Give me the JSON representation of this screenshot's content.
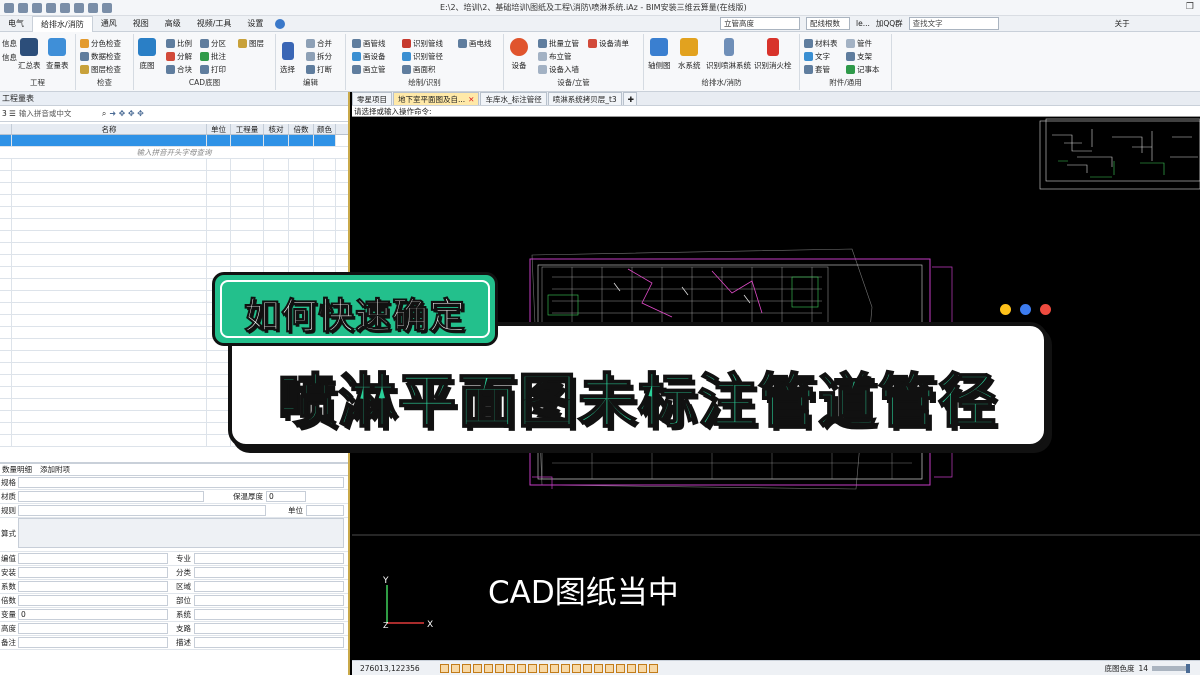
{
  "window": {
    "title": "E:\\2、培训\\2、基础培训\\图纸及工程\\消防\\喷淋系统.iAz - BIM安装三维云算量(在线版)"
  },
  "tabs": [
    "电气",
    "给排水/消防",
    "通风",
    "视图",
    "高级",
    "视频/工具",
    "设置"
  ],
  "top_tools": {
    "combo1": "立管高度",
    "combo2": "配线根数",
    "user": "le...",
    "qq": "加QQ群",
    "search_placeholder": "查找文字",
    "extra": "关于"
  },
  "ribbon": {
    "groups": [
      {
        "label": "工程",
        "items": [
          "信息",
          "信息",
          "汇总表",
          "查量表"
        ]
      },
      {
        "label": "检查",
        "items": [
          "分色检查",
          "数据检查",
          "图层检查"
        ]
      },
      {
        "label": "CAD底图",
        "items": [
          "底图",
          "比例",
          "分解",
          "合块",
          "分区",
          "批注",
          "打印",
          "图层"
        ]
      },
      {
        "label": "编辑",
        "items": [
          "选择",
          "合并",
          "拆分",
          "打断"
        ]
      },
      {
        "label": "绘制/识别",
        "items": [
          "画管线",
          "画设备",
          "画立管",
          "识别管线",
          "识别管径",
          "画面积",
          "画电线"
        ]
      },
      {
        "label": "设备/立管",
        "items": [
          "设备",
          "批量立管",
          "布立管",
          "设备入墙",
          "设备清单"
        ]
      },
      {
        "label": "给排水/消防",
        "items": [
          "轴侧图",
          "水系统",
          "识别喷淋系统",
          "识别消火栓"
        ]
      },
      {
        "label": "附件/通用",
        "items": [
          "材料表",
          "文字",
          "套管",
          "管件",
          "支架",
          "记事本"
        ]
      }
    ]
  },
  "left_panel": {
    "title": "工程量表",
    "search_placeholder": "输入拼音或中文",
    "columns": [
      "名称",
      "单位",
      "工程量",
      "核对",
      "倍数",
      "颜色"
    ],
    "hint": "输入拼音开头字母查询",
    "detail_tabs": [
      "数量明细",
      "添加附项"
    ],
    "props": {
      "spec": "规格",
      "material": "材质",
      "rule": "规则",
      "insul_thickness": "保温厚度",
      "insul_value": "0",
      "unit": "单位",
      "formula": "算式",
      "fields_left": [
        "编值",
        "安装",
        "系数",
        "倍数",
        "变量",
        "高度",
        "备注"
      ],
      "fields_right": [
        "专业",
        "分类",
        "区域",
        "部位",
        "系统",
        "支路",
        "描述"
      ],
      "var_value": "0"
    }
  },
  "doc_tabs": [
    {
      "label": "零星项目",
      "active": false
    },
    {
      "label": "地下室平面图及自...",
      "active": true
    },
    {
      "label": "车库水_标注管径",
      "active": false
    },
    {
      "label": "喷淋系统拷贝层_t3",
      "active": false
    }
  ],
  "command_prompt": "请选择或输入操作命令:",
  "status": {
    "coords": "276013,122356",
    "right_label": "底图色度",
    "right_value": "14"
  },
  "overlay": {
    "top_banner": "如何快速确定",
    "main_banner": "喷淋平面图未标注管道管径",
    "caption": "CAD图纸当中",
    "axis_y": "Y",
    "axis_x": "X",
    "axis_z": "Z"
  },
  "colors": {
    "banner_green": "#23c08c",
    "banner_text_green": "#2ad29a",
    "dot_yellow": "#ffc21a",
    "dot_blue": "#3d7cf0",
    "dot_red": "#ee4b3f",
    "cad_magenta": "#c33dc3",
    "cad_white": "#d8d8d8"
  }
}
